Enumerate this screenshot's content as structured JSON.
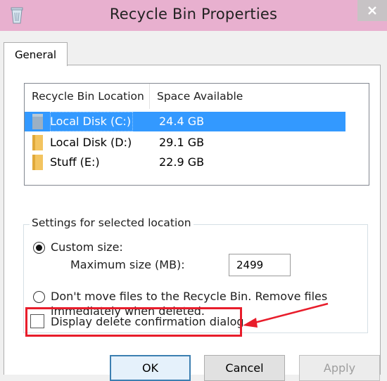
{
  "window": {
    "title": "Recycle Bin Properties",
    "icon": "recycle-bin-icon",
    "close_icon": "close-icon"
  },
  "tabs": [
    {
      "label": "General",
      "selected": true
    }
  ],
  "locations": {
    "columns": [
      "Recycle Bin Location",
      "Space Available"
    ],
    "rows": [
      {
        "name": "Local Disk (C:)",
        "space": "24.4 GB",
        "icon": "system-drive-icon",
        "selected": true
      },
      {
        "name": "Local Disk (D:)",
        "space": "29.1 GB",
        "icon": "folder-drive-icon",
        "selected": false
      },
      {
        "name": "Stuff (E:)",
        "space": "22.9 GB",
        "icon": "folder-drive-icon",
        "selected": false
      }
    ]
  },
  "settings": {
    "group_label": "Settings for selected location",
    "custom_size_label": "Custom size:",
    "custom_size_selected": true,
    "max_size_label": "Maximum size (MB):",
    "max_size_value": "2499",
    "dont_move_line1": "Don't move files to the Recycle Bin. Remove files",
    "dont_move_line2": "immediately when deleted.",
    "dont_move_selected": false
  },
  "confirmation": {
    "label": "Display delete confirmation dialog",
    "checked": false
  },
  "annotation": {
    "color": "#e81d2b"
  },
  "buttons": {
    "ok": "OK",
    "cancel": "Cancel",
    "apply": "Apply",
    "apply_enabled": false
  },
  "colors": {
    "titlebar": "#e8b0cf",
    "selection": "#3399ff",
    "folder": "#f3c460"
  }
}
